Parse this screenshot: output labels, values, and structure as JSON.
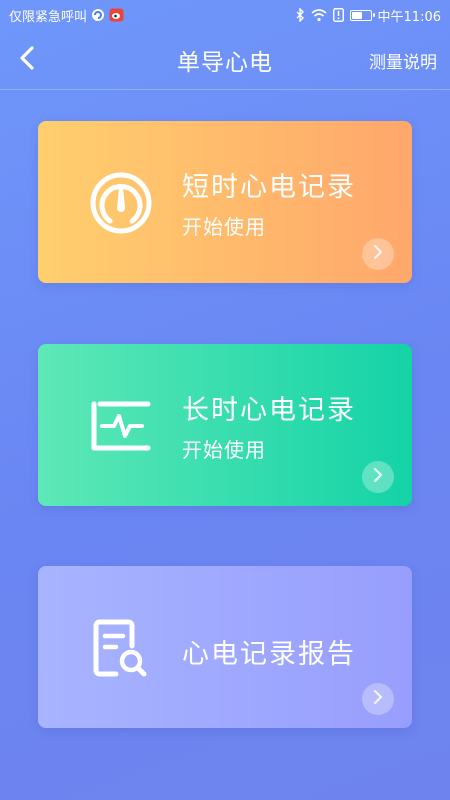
{
  "status_bar": {
    "carrier_text": "仅限紧急呼叫",
    "time": "中午11:06",
    "icons": [
      "notification-app-icon",
      "weibo-icon",
      "bluetooth-icon",
      "wifi-icon",
      "alert-icon",
      "battery-icon"
    ],
    "battery_level": 0.6
  },
  "header": {
    "title": "单导心电",
    "back_icon": "chevron-left-icon",
    "help_label": "测量说明"
  },
  "cards": {
    "short": {
      "title": "短时心电记录",
      "subtitle": "开始使用",
      "icon": "gauge-icon"
    },
    "long": {
      "title": "长时心电记录",
      "subtitle": "开始使用",
      "icon": "ecg-monitor-icon"
    },
    "report": {
      "title": "心电记录报告",
      "icon": "report-search-icon"
    }
  },
  "colors": {
    "background": "#6f8ef5",
    "short_card": [
      "#ffcf6d",
      "#ffa76c"
    ],
    "long_card": [
      "#5ee8b6",
      "#14d3a7"
    ],
    "report_card": [
      "#a8b4ff",
      "#979efd"
    ]
  }
}
